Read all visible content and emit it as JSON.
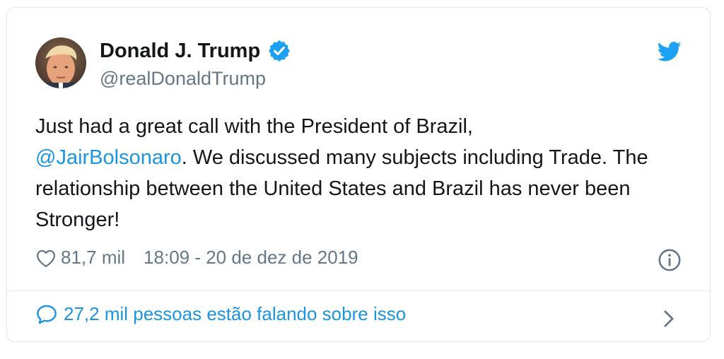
{
  "author": {
    "display_name": "Donald J. Trump",
    "handle": "@realDonaldTrump",
    "verified_icon": "verified-badge-icon",
    "avatar_icon": "avatar"
  },
  "tweet": {
    "text_before": "Just had a great call with the President of Brazil,",
    "mention": "@JairBolsonaro",
    "text_after": ". We discussed many subjects including Trade. The relationship between the United States and Brazil has never been Stronger!"
  },
  "meta": {
    "likes": "81,7 mil",
    "timestamp": "18:09 - 20 de dez de 2019"
  },
  "footer": {
    "conversation_text": "27,2 mil pessoas estão falando sobre isso"
  },
  "colors": {
    "brand_blue": "#1da1f2",
    "link_blue": "#1b95e0",
    "text": "#14171a",
    "muted": "#657786",
    "border": "#e1e8ed"
  }
}
